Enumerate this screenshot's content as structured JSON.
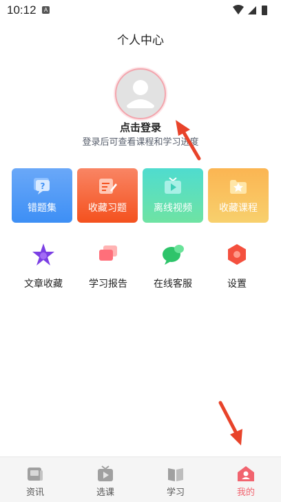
{
  "status_bar": {
    "time": "10:12",
    "notification_glyph": "A",
    "icons": [
      "wifi-icon",
      "signal-icon",
      "battery-icon"
    ]
  },
  "header": {
    "title": "个人中心"
  },
  "profile": {
    "login_label": "点击登录",
    "login_hint": "登录后可查看课程和学习进度"
  },
  "feature_cards": [
    {
      "label": "错题集",
      "icon": "question-chat-icon",
      "color": "#4a97f6"
    },
    {
      "label": "收藏习题",
      "icon": "edit-doc-icon",
      "color": "#f65c35"
    },
    {
      "label": "离线视频",
      "icon": "tv-play-icon",
      "color": "#52dcc0"
    },
    {
      "label": "收藏课程",
      "icon": "star-folder-icon",
      "color": "#f9bf5c"
    }
  ],
  "tools": [
    {
      "label": "文章收藏",
      "icon": "star-icon"
    },
    {
      "label": "学习报告",
      "icon": "report-cards-icon"
    },
    {
      "label": "在线客服",
      "icon": "chat-bubbles-icon"
    },
    {
      "label": "设置",
      "icon": "hexagon-settings-icon"
    }
  ],
  "bottom_nav": {
    "items": [
      {
        "label": "资讯",
        "icon": "news-icon",
        "active": false
      },
      {
        "label": "选课",
        "icon": "tv-icon",
        "active": false
      },
      {
        "label": "学习",
        "icon": "book-icon",
        "active": false
      },
      {
        "label": "我的",
        "icon": "user-home-icon",
        "active": true
      }
    ]
  },
  "colors": {
    "accent": "#f1646f",
    "annotation_arrow": "#e8432a",
    "nav_background": "#f5f5f5"
  }
}
